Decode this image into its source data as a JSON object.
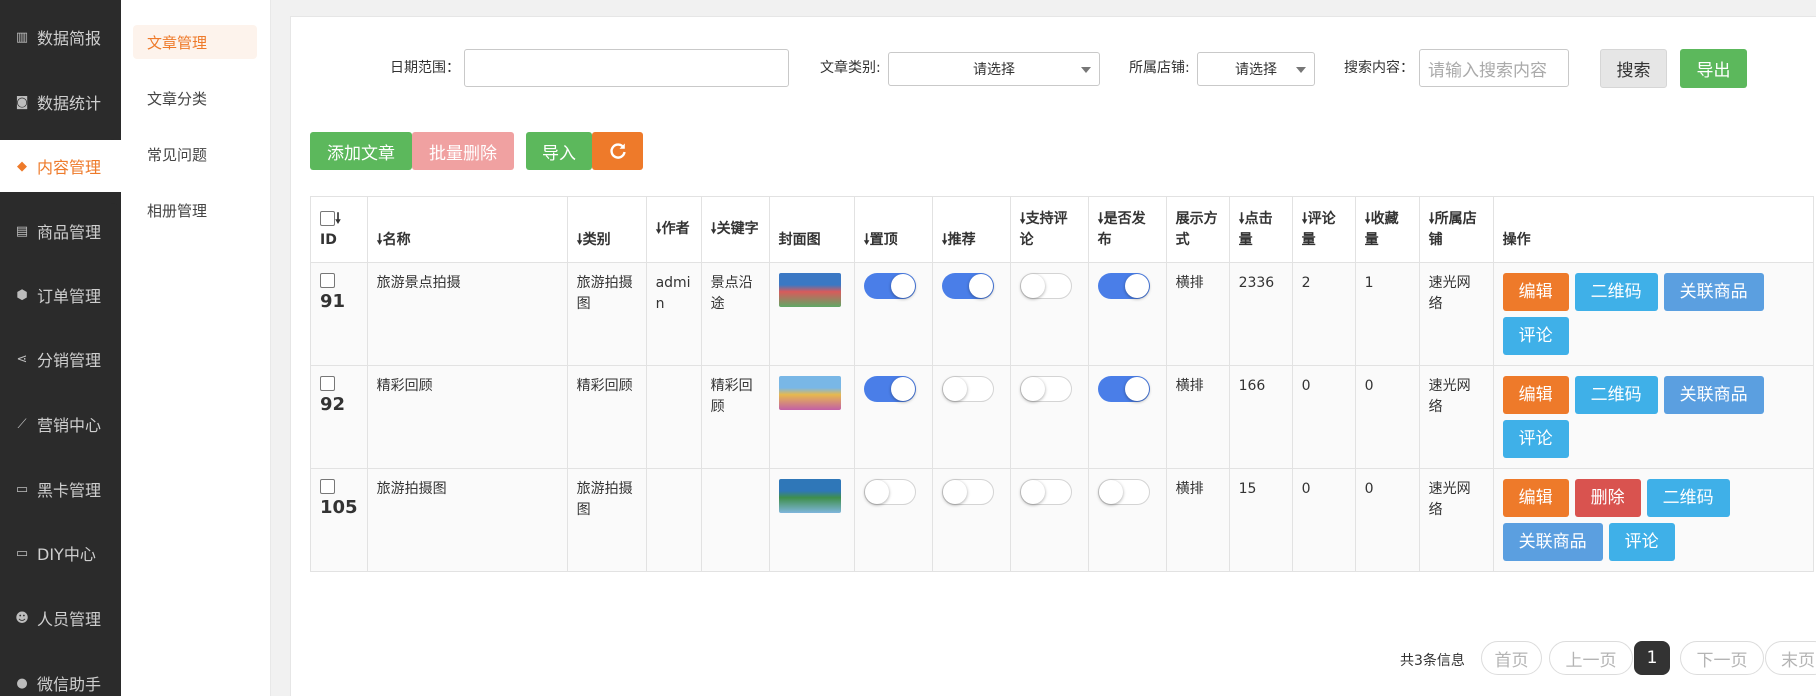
{
  "sidebar": {
    "items": [
      {
        "label": "数据简报",
        "icon": "bar-chart-icon",
        "glyph": "▥"
      },
      {
        "label": "数据统计",
        "icon": "camera-icon",
        "glyph": "◙"
      },
      {
        "label": "内容管理",
        "icon": "tag-icon",
        "glyph": "◆",
        "active": true
      },
      {
        "label": "商品管理",
        "icon": "bag-icon",
        "glyph": "▤"
      },
      {
        "label": "订单管理",
        "icon": "cube-icon",
        "glyph": "⬢"
      },
      {
        "label": "分销管理",
        "icon": "share-icon",
        "glyph": "⋖"
      },
      {
        "label": "营销中心",
        "icon": "line-chart-icon",
        "glyph": "⟋"
      },
      {
        "label": "黑卡管理",
        "icon": "card-icon",
        "glyph": "▭"
      },
      {
        "label": "DIY中心",
        "icon": "monitor-icon",
        "glyph": "▭"
      },
      {
        "label": "人员管理",
        "icon": "users-icon",
        "glyph": "☻"
      },
      {
        "label": "微信助手",
        "icon": "wechat-icon",
        "glyph": "●"
      }
    ]
  },
  "submenu": {
    "items": [
      {
        "label": "文章管理",
        "active": true
      },
      {
        "label": "文章分类"
      },
      {
        "label": "常见问题"
      },
      {
        "label": "相册管理"
      }
    ]
  },
  "filters": {
    "date_label": "日期范围：",
    "date_value": "",
    "category_label": "文章类别:",
    "category_value": "请选择",
    "store_label": "所属店铺:",
    "store_value": "请选择",
    "search_label": "搜索内容：",
    "search_placeholder": "请输入搜索内容",
    "search_button": "搜索",
    "export_button": "导出"
  },
  "toolbar": {
    "add_label": "添加文章",
    "batch_delete_label": "批量删除",
    "import_label": "导入",
    "refresh_icon": "refresh-icon"
  },
  "table": {
    "headers": {
      "id": "ID",
      "name": "名称",
      "category": "类别",
      "author": "作者",
      "keyword": "关键字",
      "cover": "封面图",
      "top": "置顶",
      "recommend": "推荐",
      "comment_enabled": "支持评论",
      "published": "是否发布",
      "display": "展示方式",
      "clicks": "点击量",
      "comments": "评论量",
      "favorites": "收藏量",
      "store": "所属店铺",
      "ops": "操作"
    },
    "rows": [
      {
        "id": "91",
        "name": "旅游景点拍摄",
        "category": "旅游拍摄图",
        "author": "admin",
        "keyword": "景点沿途",
        "cover_colors": [
          "#3b78c4",
          "#d85b5b",
          "#5fa865"
        ],
        "top": true,
        "recommend": true,
        "comment_enabled": false,
        "published": true,
        "display": "横排",
        "clicks": "2336",
        "comments": "2",
        "favorites": "1",
        "store": "速光网络",
        "ops": [
          {
            "label": "编辑",
            "kind": "orange"
          },
          {
            "label": "二维码",
            "kind": "blue"
          },
          {
            "label": "关联商品",
            "kind": "lblue"
          },
          {
            "label": "评论",
            "kind": "blue"
          }
        ]
      },
      {
        "id": "92",
        "name": "精彩回顾",
        "category": "精彩回顾",
        "author": "",
        "keyword": "精彩回顾",
        "cover_colors": [
          "#79b7e6",
          "#e7b94e",
          "#c25fa6"
        ],
        "top": true,
        "recommend": false,
        "comment_enabled": false,
        "published": true,
        "display": "横排",
        "clicks": "166",
        "comments": "0",
        "favorites": "0",
        "store": "速光网络",
        "ops": [
          {
            "label": "编辑",
            "kind": "orange"
          },
          {
            "label": "二维码",
            "kind": "blue"
          },
          {
            "label": "关联商品",
            "kind": "lblue"
          },
          {
            "label": "评论",
            "kind": "blue"
          }
        ]
      },
      {
        "id": "105",
        "name": "旅游拍摄图",
        "category": "旅游拍摄图",
        "author": "",
        "keyword": "",
        "cover_colors": [
          "#2f77b8",
          "#3f8f4c",
          "#7fb6dc"
        ],
        "top": false,
        "recommend": false,
        "comment_enabled": false,
        "published": false,
        "display": "横排",
        "clicks": "15",
        "comments": "0",
        "favorites": "0",
        "store": "速光网络",
        "ops": [
          {
            "label": "编辑",
            "kind": "orange"
          },
          {
            "label": "删除",
            "kind": "red"
          },
          {
            "label": "二维码",
            "kind": "blue"
          },
          {
            "label": "关联商品",
            "kind": "lblue"
          },
          {
            "label": "评论",
            "kind": "blue"
          }
        ]
      }
    ]
  },
  "pagination": {
    "info": "共3条信息",
    "first": "首页",
    "prev": "上一页",
    "current": "1",
    "next": "下一页",
    "last": "末页"
  },
  "colors": {
    "accent": "#ee7a2a",
    "sidebar_bg": "#2b2b2b",
    "toggle_on": "#4a7ee8",
    "green": "#5cb85c"
  }
}
